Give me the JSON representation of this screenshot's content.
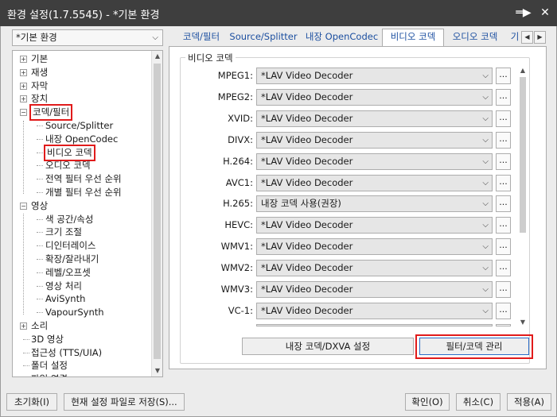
{
  "window": {
    "title": "환경 설정(1.7.5545) - *기본 환경",
    "pin_glyph": "═▶",
    "close_glyph": "✕"
  },
  "profile": {
    "selected": "*기본 환경"
  },
  "tree": {
    "items": [
      {
        "label": "기본",
        "expander": "+"
      },
      {
        "label": "재생",
        "expander": "+"
      },
      {
        "label": "자막",
        "expander": "+"
      },
      {
        "label": "장치",
        "expander": "+"
      },
      {
        "label": "코덱/필터",
        "expander": "−"
      },
      {
        "label": "Source/Splitter"
      },
      {
        "label": "내장 OpenCodec"
      },
      {
        "label": "비디오 코덱"
      },
      {
        "label": "오디오 코덱"
      },
      {
        "label": "전역 필터 우선 순위"
      },
      {
        "label": "개별 필터 우선 순위"
      },
      {
        "label": "영상",
        "expander": "−"
      },
      {
        "label": "색 공간/속성"
      },
      {
        "label": "크기 조절"
      },
      {
        "label": "디인터레이스"
      },
      {
        "label": "확장/잘라내기"
      },
      {
        "label": "레벨/오프셋"
      },
      {
        "label": "영상 처리"
      },
      {
        "label": "AviSynth"
      },
      {
        "label": "VapourSynth"
      },
      {
        "label": "소리",
        "expander": "+"
      },
      {
        "label": "3D 영상"
      },
      {
        "label": "접근성 (TTS/UIA)"
      },
      {
        "label": "폴더 설정"
      },
      {
        "label": "파일 연결"
      }
    ]
  },
  "tabs": [
    {
      "label": "코덱/필터"
    },
    {
      "label": "Source/Splitter"
    },
    {
      "label": "내장 OpenCodec"
    },
    {
      "label": "비디오 코덱"
    },
    {
      "label": "오디오 코덱"
    },
    {
      "label": "기"
    }
  ],
  "tab_nav": {
    "prev": "◀",
    "next": "▶"
  },
  "group": {
    "title": "비디오 코덱"
  },
  "codec_rows": [
    {
      "label": "MPEG1:",
      "value": "*LAV Video Decoder"
    },
    {
      "label": "MPEG2:",
      "value": "*LAV Video Decoder"
    },
    {
      "label": "XVID:",
      "value": "*LAV Video Decoder"
    },
    {
      "label": "DIVX:",
      "value": "*LAV Video Decoder"
    },
    {
      "label": "H.264:",
      "value": "*LAV Video Decoder"
    },
    {
      "label": "AVC1:",
      "value": "*LAV Video Decoder"
    },
    {
      "label": "H.265:",
      "value": "내장 코덱 사용(권장)"
    },
    {
      "label": "HEVC:",
      "value": "*LAV Video Decoder"
    },
    {
      "label": "WMV1:",
      "value": "*LAV Video Decoder"
    },
    {
      "label": "WMV2:",
      "value": "*LAV Video Decoder"
    },
    {
      "label": "WMV3:",
      "value": "*LAV Video Decoder"
    },
    {
      "label": "VC-1:",
      "value": "*LAV Video Decoder"
    },
    {
      "label": "",
      "value": ""
    }
  ],
  "more_button_label": "...",
  "panel_buttons": {
    "builtin_codec": "내장 코덱/DXVA 설정",
    "filter_codec_manage": "필터/코덱 관리"
  },
  "footer_buttons": {
    "reset": "초기화(I)",
    "save_current": "현재 설정 파일로 저장(S)...",
    "ok": "확인(O)",
    "cancel": "취소(C)",
    "apply": "적용(A)"
  },
  "colors": {
    "titlebar": "#3e3e3e",
    "tab_text": "#1c4fa0",
    "highlight_box": "#e11b1b"
  }
}
